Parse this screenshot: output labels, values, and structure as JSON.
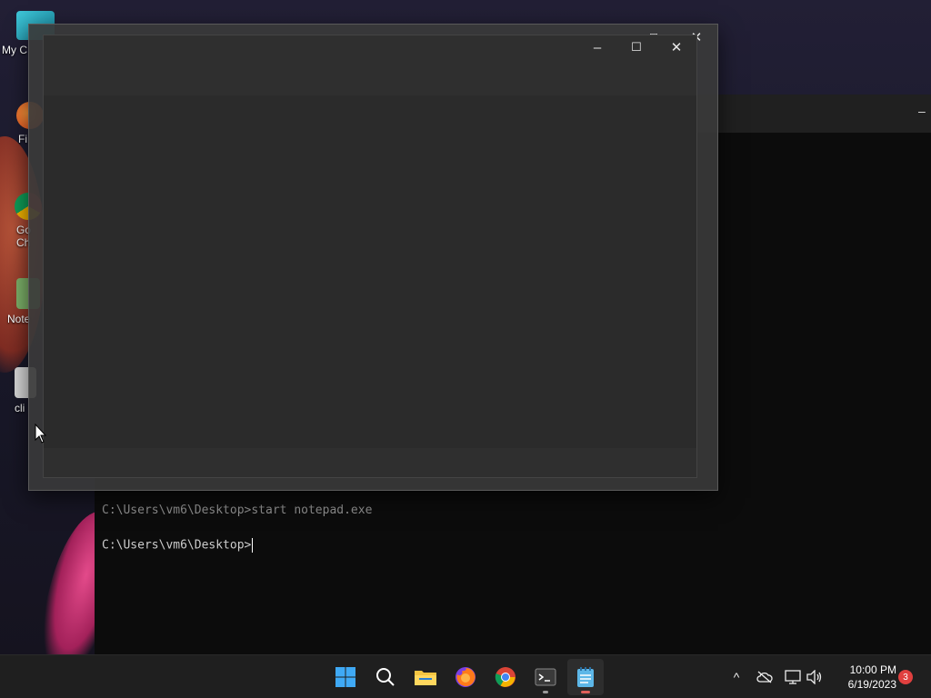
{
  "desktop": {
    "icons": [
      {
        "label": "My C",
        "icon": "computer-icon"
      },
      {
        "label": "Fi",
        "icon": "firefox-shortcut-icon"
      },
      {
        "label": "Go",
        "label2": "Ch",
        "icon": "chrome-shortcut-icon"
      },
      {
        "label": "Note",
        "icon": "notepad-shortcut-icon"
      },
      {
        "label": "cli",
        "icon": "file-icon"
      }
    ]
  },
  "terminal": {
    "lines": [
      "C:\\Users\\vm6\\Desktop>start notepad.exe",
      "C:\\Users\\vm6\\Desktop>"
    ]
  },
  "window_controls": {
    "minimize": "–",
    "maximize": "☐",
    "close": "✕"
  },
  "taskbar": {
    "apps": [
      {
        "name": "start",
        "icon": "windows-start-icon"
      },
      {
        "name": "search",
        "icon": "search-icon"
      },
      {
        "name": "file-explorer",
        "icon": "folder-icon"
      },
      {
        "name": "firefox",
        "icon": "firefox-icon"
      },
      {
        "name": "chrome",
        "icon": "chrome-icon"
      },
      {
        "name": "terminal",
        "icon": "terminal-icon"
      },
      {
        "name": "notepad",
        "icon": "notepad-icon"
      }
    ],
    "tray": {
      "chevron": "^",
      "time": "10:00 PM",
      "date": "6/19/2023",
      "notification_count": "3"
    }
  }
}
